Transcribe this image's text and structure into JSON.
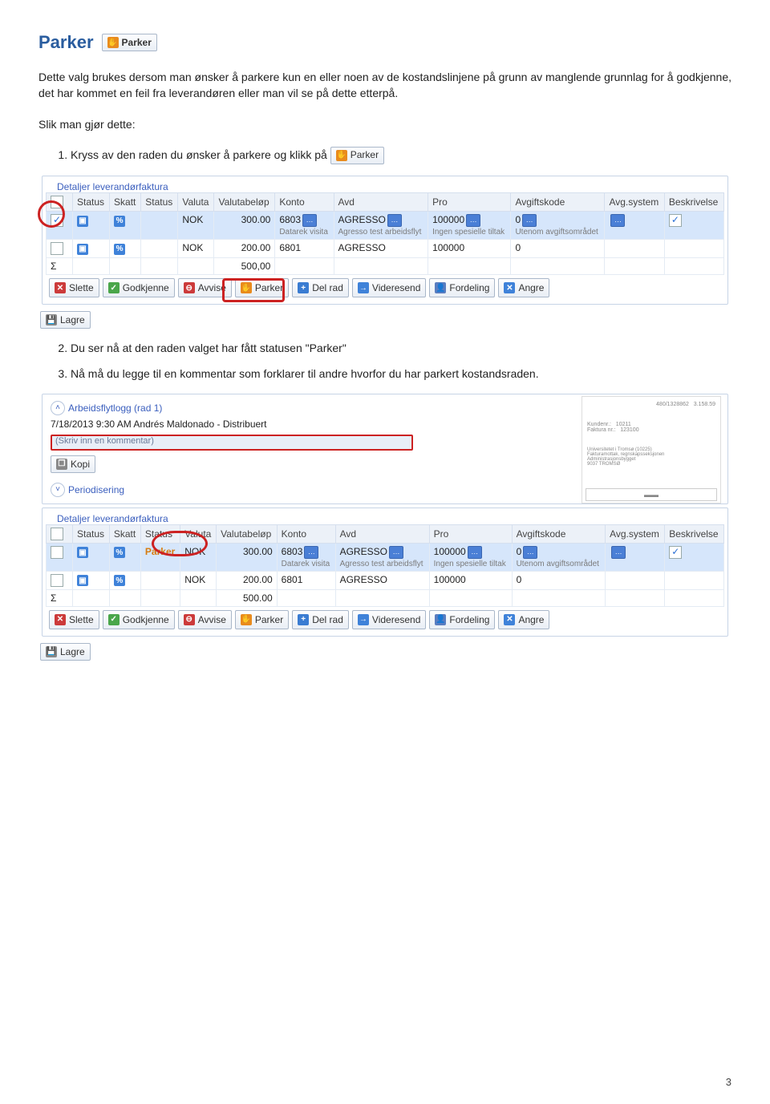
{
  "page": {
    "title": "Parker",
    "parker_btn_label": "Parker",
    "intro": "Dette valg brukes dersom man ønsker å parkere kun en eller noen av de kostandslinjene på grunn av manglende grunnlag for å godkjenne, det har kommet en feil fra leverandøren eller man vil se på dette etterpå.",
    "howto_label": "Slik man gjør dette:",
    "step1": "Kryss av den raden du ønsker å parkere og klikk på",
    "step2": "Du ser nå at den raden valget har fått statusen \"Parker\"",
    "step3": "Nå må du legge til en kommentar som forklarer til andre hvorfor du har parkert kostandsraden.",
    "page_number": "3"
  },
  "grid1": {
    "legend": "Detaljer leverandørfaktura",
    "headers": [
      "",
      "Status",
      "Skatt",
      "Status",
      "Valuta",
      "Valutabeløp",
      "Konto",
      "Avd",
      "Pro",
      "Avgiftskode",
      "Avg.system",
      "Beskrivelse"
    ],
    "rows": [
      {
        "checked": "✓",
        "valuta": "NOK",
        "belop": "300.00",
        "konto": "6803",
        "konto_sub": "Datarek visita",
        "avd": "AGRESSO",
        "avd_sub": "Agresso test arbeidsflyt",
        "pro": "100000",
        "pro_sub": "Ingen spesielle tiltak",
        "avgkode": "0",
        "avgkode_sub": "Utenom avgiftsområdet"
      },
      {
        "checked": "",
        "valuta": "NOK",
        "belop": "200.00",
        "konto": "6801",
        "avd": "AGRESSO",
        "pro": "100000",
        "avgkode": "0"
      }
    ],
    "sum": "500,00",
    "sum_sym": "Σ"
  },
  "grid2": {
    "legend": "Detaljer leverandørfaktura",
    "headers": [
      "",
      "Status",
      "Skatt",
      "Status",
      "Valuta",
      "Valutabeløp",
      "Konto",
      "Avd",
      "Pro",
      "Avgiftskode",
      "Avg.system",
      "Beskrivelse"
    ],
    "rows": [
      {
        "status2": "Parker",
        "valuta": "NOK",
        "belop": "300.00",
        "konto": "6803",
        "konto_sub": "Datarek visita",
        "avd": "AGRESSO",
        "avd_sub": "Agresso test arbeidsflyt",
        "pro": "100000",
        "pro_sub": "Ingen spesielle tiltak",
        "avgkode": "0",
        "avgkode_sub": "Utenom avgiftsområdet"
      },
      {
        "status2": "",
        "valuta": "NOK",
        "belop": "200.00",
        "konto": "6801",
        "avd": "AGRESSO",
        "pro": "100000",
        "avgkode": "0"
      }
    ],
    "sum": "500.00",
    "sum_sym": "Σ"
  },
  "actions": {
    "slette": "Slette",
    "godkjenne": "Godkjenne",
    "avvise": "Avvise",
    "parker": "Parker",
    "delrad": "Del rad",
    "videresend": "Videresend",
    "fordeling": "Fordeling",
    "angre": "Angre",
    "lagre": "Lagre",
    "kopi": "Kopi"
  },
  "wflog": {
    "title": "Arbeidsflytlogg (rad 1)",
    "entry": "7/18/2013 9:30 AM Andrés Maldonado - Distribuert",
    "comment_placeholder": "(Skriv inn en kommentar)",
    "periodisering": "Periodisering"
  },
  "glyphs": {
    "check": "✓",
    "dots": "…",
    "arrow": "→",
    "x": "✕",
    "plus": "+"
  }
}
